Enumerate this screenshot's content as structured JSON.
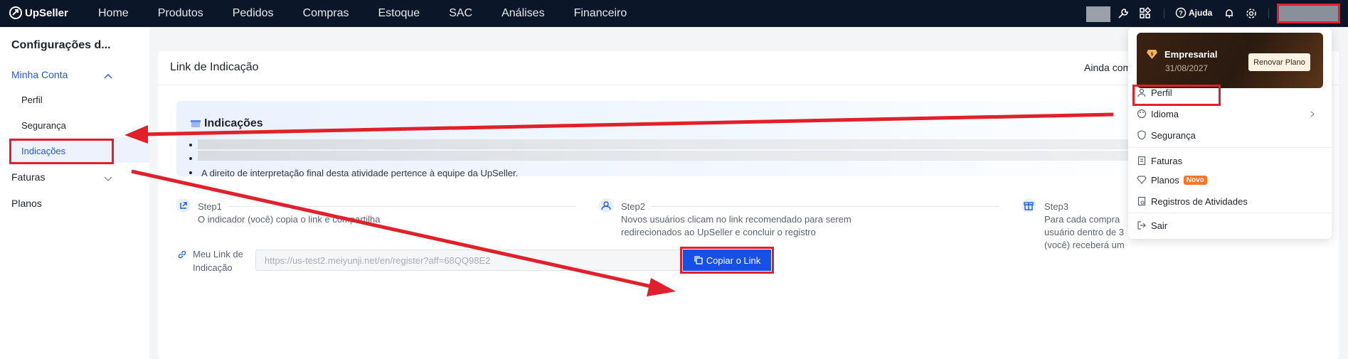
{
  "brand": {
    "name": "UpSeller"
  },
  "nav": [
    "Home",
    "Produtos",
    "Pedidos",
    "Compras",
    "Estoque",
    "SAC",
    "Análises",
    "Financeiro"
  ],
  "topbar": {
    "help_label": "Ajuda"
  },
  "sidebar": {
    "title": "Configurações d...",
    "groups": [
      {
        "label": "Minha Conta",
        "items": [
          "Perfil",
          "Segurança",
          "Indicações"
        ]
      },
      {
        "label": "Faturas"
      },
      {
        "label": "Planos"
      }
    ]
  },
  "main": {
    "title": "Link de Indicação",
    "right_text": "Ainda com",
    "banner_title": "Indicações",
    "note": "A direito de interpretação final desta atividade pertence à equipe da UpSeller.",
    "steps": [
      {
        "label": "Step1",
        "desc": "O indicador (você) copia o link e compartilha"
      },
      {
        "label": "Step2",
        "desc": "Novos usuários clicam no link recomendado para serem redirecionados ao UpSeller e concluir o registro"
      },
      {
        "label": "Step3",
        "desc": "Para cada compra\nusuário dentro de 3\n(você) receberá um"
      }
    ],
    "link_label": "Meu Link de Indicação",
    "link_value": "https://us-test2.meiyunji.net/en/register?aff=68QQ98E2",
    "copy_button": "Copiar o Link"
  },
  "account_menu": {
    "plan_name": "Empresarial",
    "plan_date": "31/08/2027",
    "renew_button": "Renovar Plano",
    "items": [
      {
        "label": "Perfil",
        "icon": "user-icon"
      },
      {
        "label": "Idioma",
        "icon": "palette-icon"
      },
      {
        "label": "Segurança",
        "icon": "shield-icon"
      },
      {
        "label": "Faturas",
        "icon": "invoice-icon"
      },
      {
        "label": "Planos",
        "icon": "diamond-icon",
        "badge": "Novo"
      },
      {
        "label": "Registros de Atividades",
        "icon": "log-icon"
      },
      {
        "label": "Sair",
        "icon": "logout-icon"
      }
    ]
  },
  "colors": {
    "annotation_red": "#e0202a",
    "primary_blue": "#1651e3",
    "nav_bg": "#0b1728"
  }
}
